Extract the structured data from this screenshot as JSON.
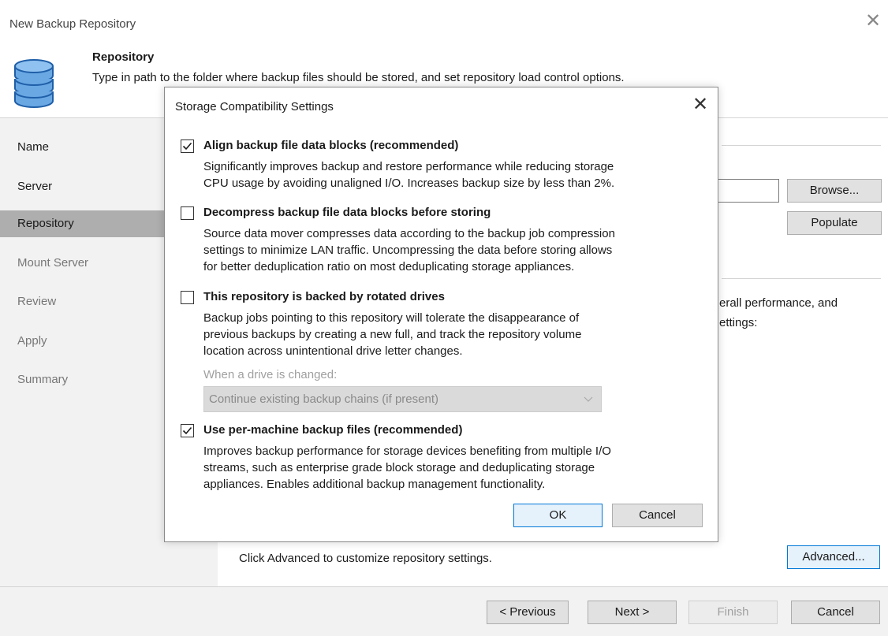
{
  "window": {
    "title": "New Backup Repository",
    "close_glyph": "✕"
  },
  "header": {
    "icon": "database-icon",
    "title": "Repository",
    "subtitle": "Type in path to the folder where backup files should be stored, and set repository load control options."
  },
  "sidebar": {
    "items": [
      {
        "label": "Name"
      },
      {
        "label": "Server"
      },
      {
        "label": "Repository"
      },
      {
        "label": "Mount Server"
      },
      {
        "label": "Review"
      },
      {
        "label": "Apply"
      },
      {
        "label": "Summary"
      }
    ],
    "active_item": "Repository"
  },
  "content": {
    "browse_label": "Browse...",
    "populate_label": "Populate",
    "partial_line_1": "erall performance, and",
    "partial_line_2": "ettings:",
    "advanced_hint": "Click Advanced to customize repository settings.",
    "advanced_label": "Advanced..."
  },
  "footer": {
    "previous_label": "< Previous",
    "next_label": "Next >",
    "finish_label": "Finish",
    "cancel_label": "Cancel"
  },
  "dialog": {
    "title": "Storage Compatibility Settings",
    "close_glyph": "✕",
    "options": [
      {
        "label": "Align backup file data blocks (recommended)",
        "checked": true,
        "desc": [
          "Significantly improves backup and restore performance while reducing storage",
          "CPU usage by avoiding unaligned I/O. Increases backup size by less than 2%."
        ]
      },
      {
        "label": "Decompress backup file data blocks before storing",
        "checked": false,
        "desc": [
          "Source data mover compresses data according to the backup job compression",
          "settings to minimize LAN traffic. Uncompressing the data before storing allows",
          "for better deduplication ratio on most deduplicating storage appliances."
        ]
      },
      {
        "label": "This repository is backed by rotated drives",
        "checked": false,
        "desc": [
          "Backup jobs pointing to this repository will tolerate the disappearance of",
          "previous backups by creating a new full, and track the repository volume",
          "location across unintentional drive letter changes."
        ]
      },
      {
        "label": "Use per-machine backup files (recommended)",
        "checked": true,
        "desc": [
          "Improves backup performance for storage devices benefiting from multiple I/O",
          "streams, such as enterprise grade block storage and deduplicating storage",
          "appliances. Enables additional backup management functionality."
        ]
      }
    ],
    "drive_change": {
      "label": "When a drive is changed:",
      "selected": "Continue existing backup chains (if present)",
      "enabled": false
    },
    "ok_label": "OK",
    "cancel_label": "Cancel"
  },
  "colors": {
    "accent": "#0078d7",
    "sidebar_bg": "#f2f2f2",
    "sidebar_active": "#aeaeae",
    "db_icon": "#4a8fd4"
  }
}
